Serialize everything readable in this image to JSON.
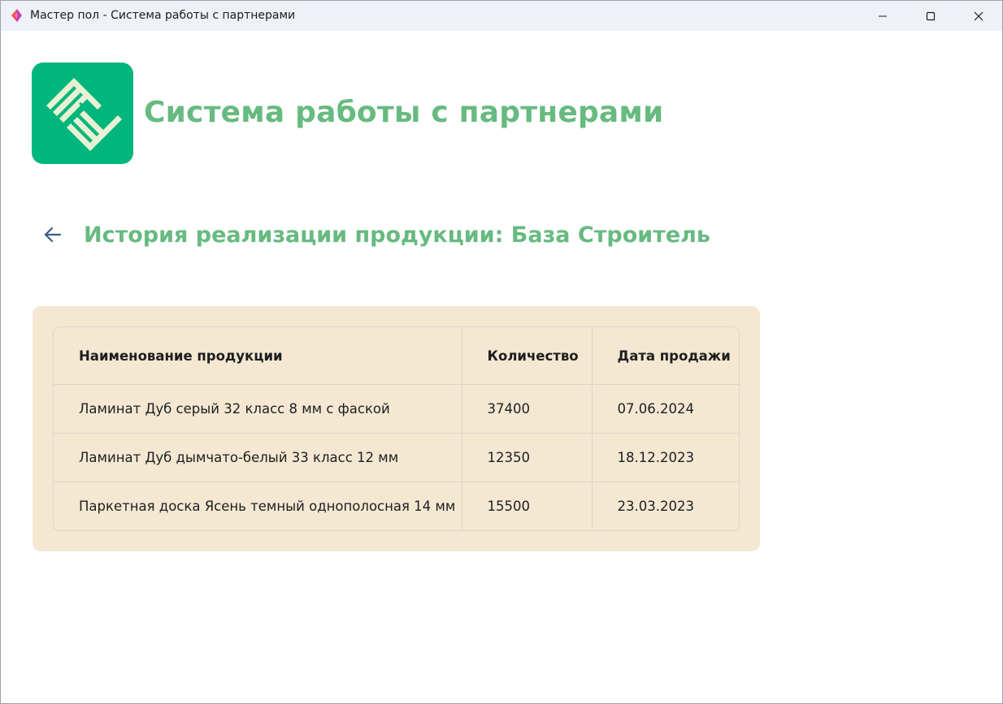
{
  "window": {
    "title": "Мастер пол - Система работы с партнерами"
  },
  "header": {
    "app_title": "Система работы с партнерами"
  },
  "section": {
    "title": "История реализации продукции: База Строитель"
  },
  "table": {
    "columns": [
      "Наименование продукции",
      "Количество",
      "Дата продажи"
    ],
    "rows": [
      [
        "Ламинат Дуб серый 32 класс 8 мм с фаской",
        "37400",
        "07.06.2024"
      ],
      [
        "Ламинат Дуб дымчато-белый 33 класс 12 мм",
        "12350",
        "18.12.2023"
      ],
      [
        "Паркетная доска Ясень темный однополосная 14 мм",
        "15500",
        "23.03.2023"
      ]
    ]
  },
  "icons": {
    "app": "app-icon",
    "logo": "logo-icon",
    "minimize": "minimize-icon",
    "maximize": "maximize-icon",
    "close": "close-icon",
    "back": "arrow-left-icon"
  },
  "colors": {
    "accent_green": "#67ba80",
    "logo_green": "#00b67c",
    "card_beige": "#f4e8d3",
    "back_arrow": "#3b5e8a"
  }
}
